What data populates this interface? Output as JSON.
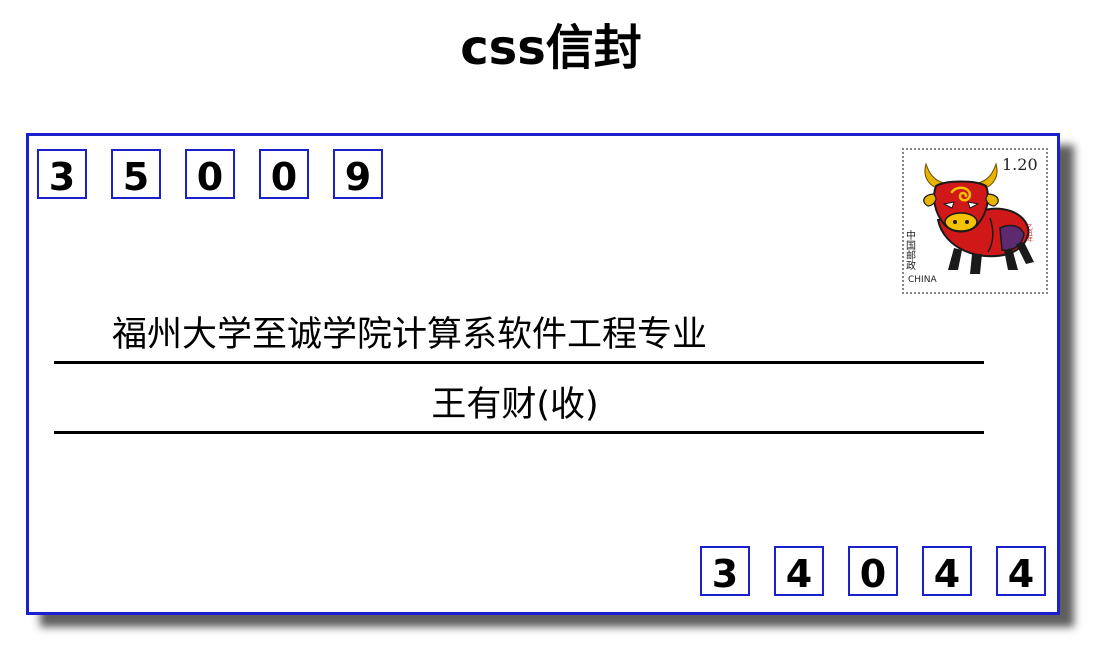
{
  "page": {
    "title": "css信封"
  },
  "envelope": {
    "sender_zip": [
      "3",
      "5",
      "0",
      "0",
      "9"
    ],
    "recipient_address": "福州大学至诚学院计算系软件工程专业",
    "recipient_name": "王有财(收)",
    "recipient_zip": [
      "3",
      "4",
      "0",
      "4",
      "4"
    ],
    "border_color": "#1a21cc"
  },
  "stamp": {
    "icon": "ox-stamp-icon",
    "denomination": "1.20",
    "country_cn": "中国邮政",
    "country_en": "CHINA",
    "year_mark": "乙丑年"
  }
}
